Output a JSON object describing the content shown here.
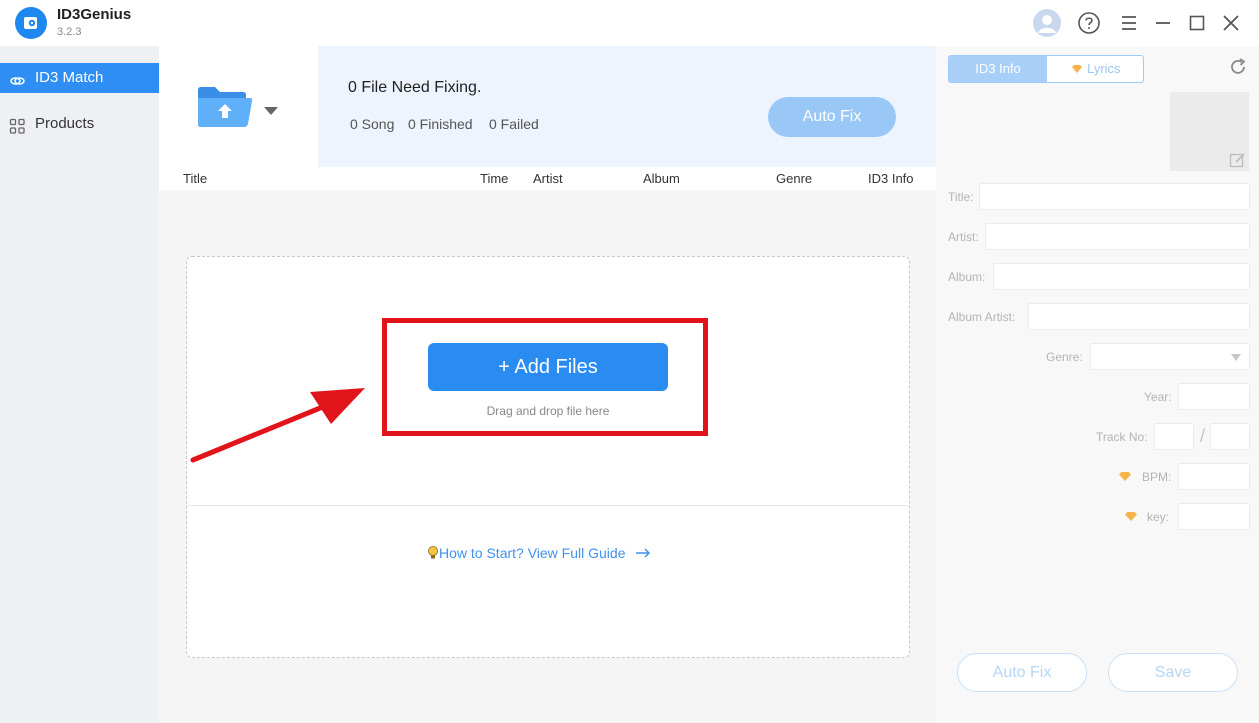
{
  "app": {
    "name": "ID3Genius",
    "version": "3.2.3"
  },
  "sidebar": {
    "items": [
      {
        "label": "ID3 Match"
      },
      {
        "label": "Products"
      }
    ]
  },
  "status": {
    "title": "0 File Need Fixing.",
    "songs": "0 Song",
    "finished": "0 Finished",
    "failed": "0 Failed",
    "auto_fix": "Auto Fix"
  },
  "table": {
    "columns": [
      "Title",
      "Time",
      "Artist",
      "Album",
      "Genre",
      "ID3 Info"
    ]
  },
  "dropzone": {
    "add_files": "+ Add Files",
    "drag_hint": "Drag and drop file here",
    "guide": "How to Start? View Full Guide"
  },
  "panel": {
    "tabs": [
      "ID3 Info",
      "Lyrics"
    ],
    "fields": {
      "title": "Title:",
      "artist": "Artist:",
      "album": "Album:",
      "album_artist": "Album Artist:",
      "genre": "Genre:",
      "year": "Year:",
      "track_no": "Track No:",
      "track_sep": "/",
      "bpm": "BPM:",
      "key": "key:"
    },
    "auto_fix": "Auto Fix",
    "save": "Save"
  },
  "colors": {
    "accent": "#2a8cf0",
    "highlight": "#e1141c",
    "premium": "#f5b34a"
  }
}
